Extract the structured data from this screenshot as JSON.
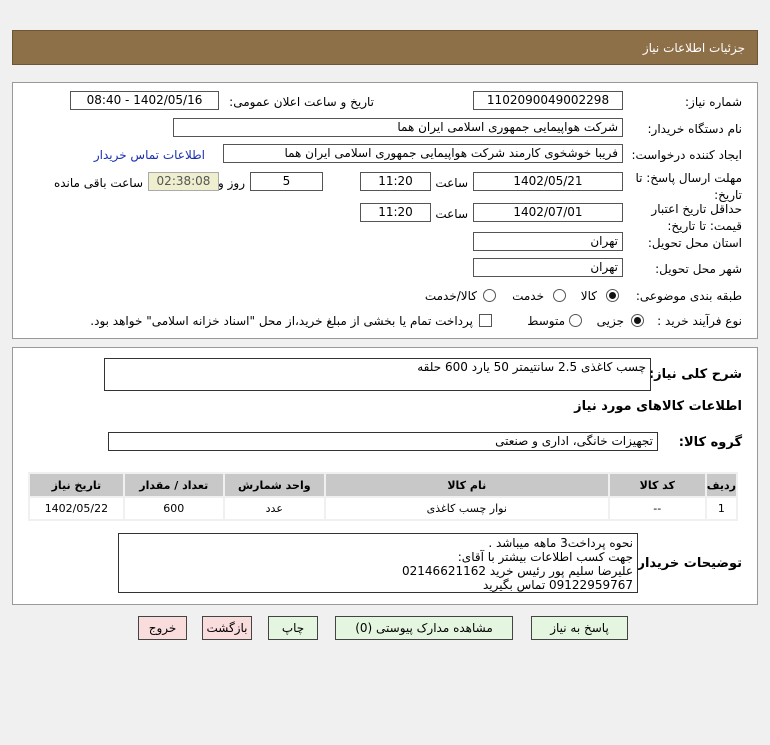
{
  "header": {
    "title": "جزئیات اطلاعات نیاز"
  },
  "form": {
    "need_number_label": "شماره نیاز:",
    "need_number": "1102090049002298",
    "announce_label": "تاریخ و ساعت اعلان عمومی:",
    "announce_value": "1402/05/16 - 08:40",
    "buyer_label": "نام دستگاه خریدار:",
    "buyer": "شرکت هواپیمایی جمهوری اسلامی ایران هما",
    "creator_label": "ایجاد کننده درخواست:",
    "creator": "فریبا خوشخوی کارمند شرکت هواپیمایی جمهوری اسلامی ایران هما",
    "contact_link": "اطلاعات تماس خریدار",
    "deadline_label": "مهلت ارسال پاسخ: تا تاریخ:",
    "deadline_date": "1402/05/21",
    "time_label": "ساعت",
    "deadline_time": "11:20",
    "days": "5",
    "days_label": "روز و",
    "remaining": "02:38:08",
    "remaining_label": "ساعت باقی مانده",
    "validity_label": "حداقل تاریخ اعتبار قیمت: تا تاریخ:",
    "validity_date": "1402/07/01",
    "validity_time": "11:20",
    "province_label": "استان محل تحویل:",
    "province": "تهران",
    "city_label": "شهر محل تحویل:",
    "city": "تهران",
    "category_label": "طبقه بندی موضوعی:",
    "category_options": [
      "کالا",
      "خدمت",
      "کالا/خدمت"
    ],
    "category_selected": "کالا",
    "process_label": "نوع فرآیند خرید :",
    "process_options": [
      "جزیی",
      "متوسط"
    ],
    "process_selected": "جزیی",
    "treasury_text": "پرداخت تمام یا بخشی از مبلغ خرید،از محل \"اسناد خزانه اسلامی\" خواهد بود."
  },
  "details": {
    "desc_label": "شرح کلی نیاز:",
    "desc": "چسب کاغذی 2.5 سانتیمتر 50 یارد 600 حلقه",
    "goods_title": "اطلاعات کالاهای مورد نیاز",
    "group_label": "گروه کالا:",
    "group": "تجهیزات خانگی، اداری و صنعتی",
    "table": {
      "headers": [
        "ردیف",
        "کد کالا",
        "نام کالا",
        "واحد شمارش",
        "تعداد / مقدار",
        "تاریخ نیاز"
      ],
      "rows": [
        [
          "1",
          "--",
          "نوار چسب کاغذی",
          "عدد",
          "600",
          "1402/05/22"
        ]
      ]
    },
    "notes_label": "توضیحات خریدار:",
    "notes": [
      "نحوه پرداخت3 ماهه میباشد .",
      "جهت کسب اطلاعات بیشتر با آقای:",
      "علیرضا سلیم پور رئیس  خرید  02146621162",
      "09122959767 تماس بگیرید"
    ]
  },
  "buttons": {
    "reply": "پاسخ به نیاز",
    "attachments": "مشاهده مدارک پیوستی (0)",
    "print": "چاپ",
    "back": "بازگشت",
    "exit": "خروج"
  }
}
